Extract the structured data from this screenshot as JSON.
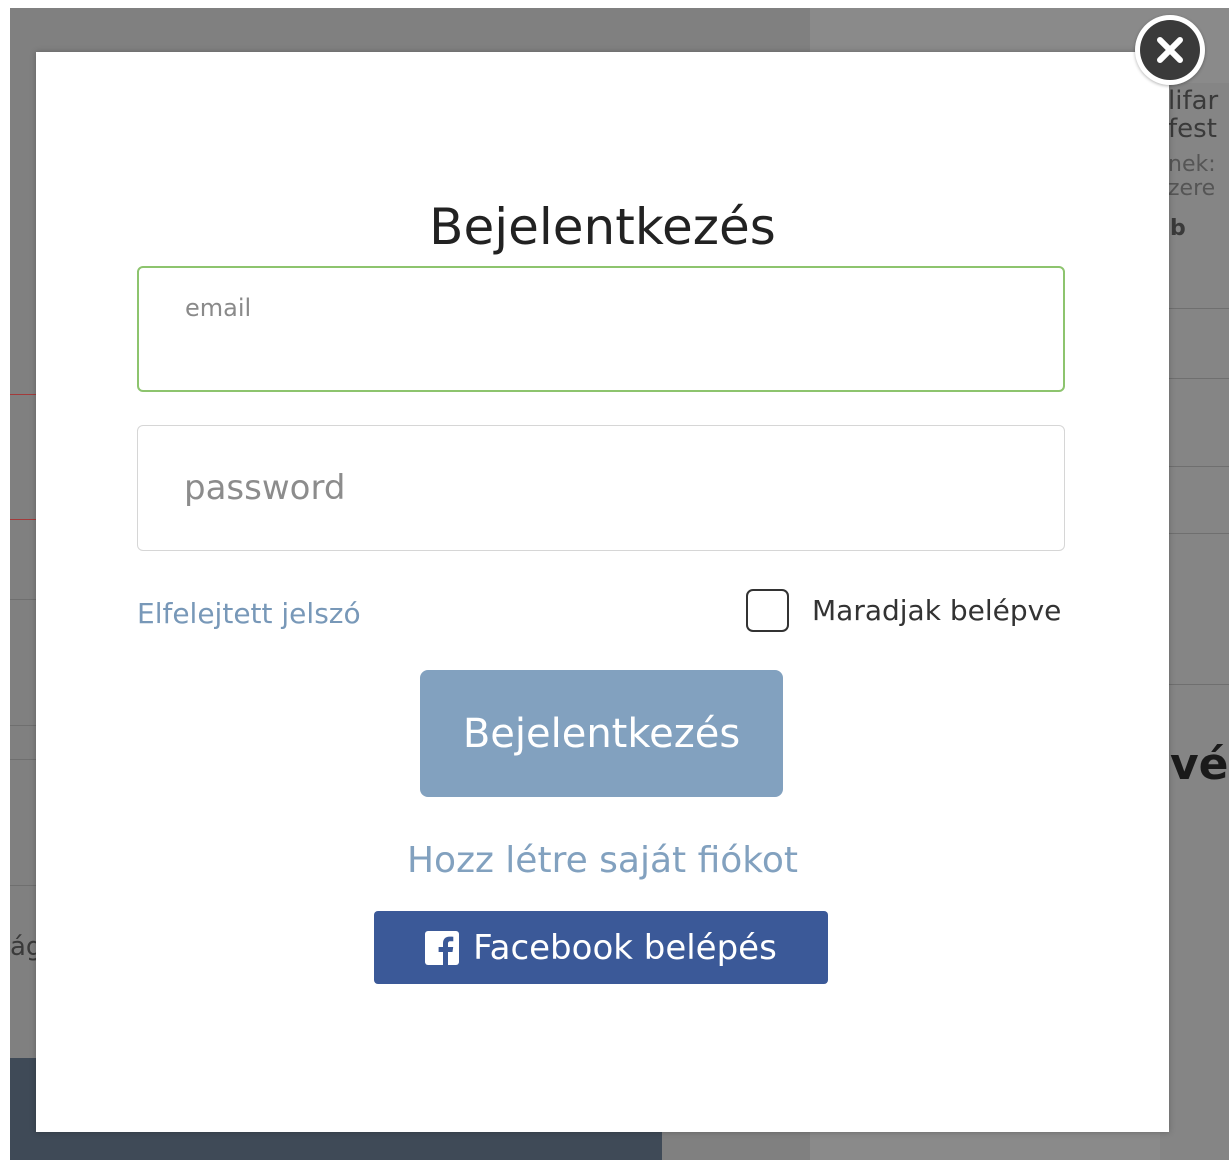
{
  "background_page": {
    "right_snippets": [
      "lifar",
      "fest",
      "nek:",
      "zere",
      "b"
    ],
    "left_snippet": "ág",
    "right_heading_fragment": "vé"
  },
  "modal": {
    "title": "Bejelentkezés",
    "close_icon": "close-icon",
    "email_field": {
      "label": "email",
      "value": ""
    },
    "password_field": {
      "placeholder": "password",
      "value": ""
    },
    "forgot_password_label": "Elfelejtett jelszó",
    "remember_me": {
      "label": "Maradjak belépve",
      "checked": false
    },
    "login_button_label": "Bejelentkezés",
    "create_account_label": "Hozz létre saját fiókot",
    "facebook_button": {
      "label": "Facebook belépés",
      "icon": "facebook-icon"
    }
  },
  "colors": {
    "accent": "#82a1bf",
    "link": "#7898b8",
    "facebook": "#3b5998",
    "email_focus_border": "#8dc46e",
    "overlay": "#808080"
  }
}
